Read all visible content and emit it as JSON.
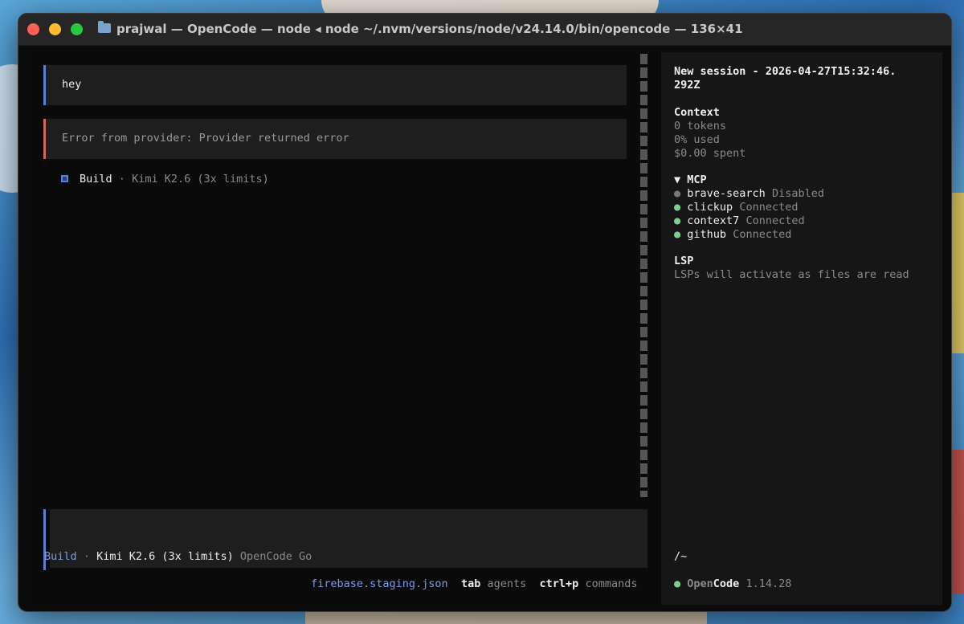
{
  "window": {
    "title": "prajwal — OpenCode — node ◂ node ~/.nvm/versions/node/v24.14.0/bin/opencode — 136×41"
  },
  "chat": {
    "user_message": "hey",
    "error_message": "Error from provider: Provider returned error",
    "build": {
      "agent": "Build",
      "separator": "·",
      "model": "Kimi K2.6 (3x limits)"
    }
  },
  "input": {
    "value": "",
    "agent": "Build",
    "separator": "·",
    "model": "Kimi K2.6 (3x limits)",
    "provider": "OpenCode Go"
  },
  "footer": {
    "file": "firebase.staging.json",
    "tab_key": "tab",
    "tab_label": "agents",
    "cmd_key": "ctrl+p",
    "cmd_label": "commands"
  },
  "sidebar": {
    "session_line1": "New session - 2026-04-27T15:32:46.",
    "session_line2": "292Z",
    "context": {
      "heading": "Context",
      "tokens": "0 tokens",
      "used": "0% used",
      "spent": "$0.00 spent"
    },
    "mcp": {
      "heading": "▼ MCP",
      "servers": [
        {
          "name": "brave-search",
          "status": "Disabled"
        },
        {
          "name": "clickup",
          "status": "Connected"
        },
        {
          "name": "context7",
          "status": "Connected"
        },
        {
          "name": "github",
          "status": "Connected"
        }
      ]
    },
    "lsp": {
      "heading": "LSP",
      "text": "LSPs will activate as files are read"
    },
    "path": "/~",
    "app": {
      "name_open": "Open",
      "name_code": "Code",
      "version": "1.14.28"
    }
  },
  "colors": {
    "accent_blue": "#5b7fd6",
    "error_red": "#d0695b",
    "connected_green": "#7fd08a"
  }
}
